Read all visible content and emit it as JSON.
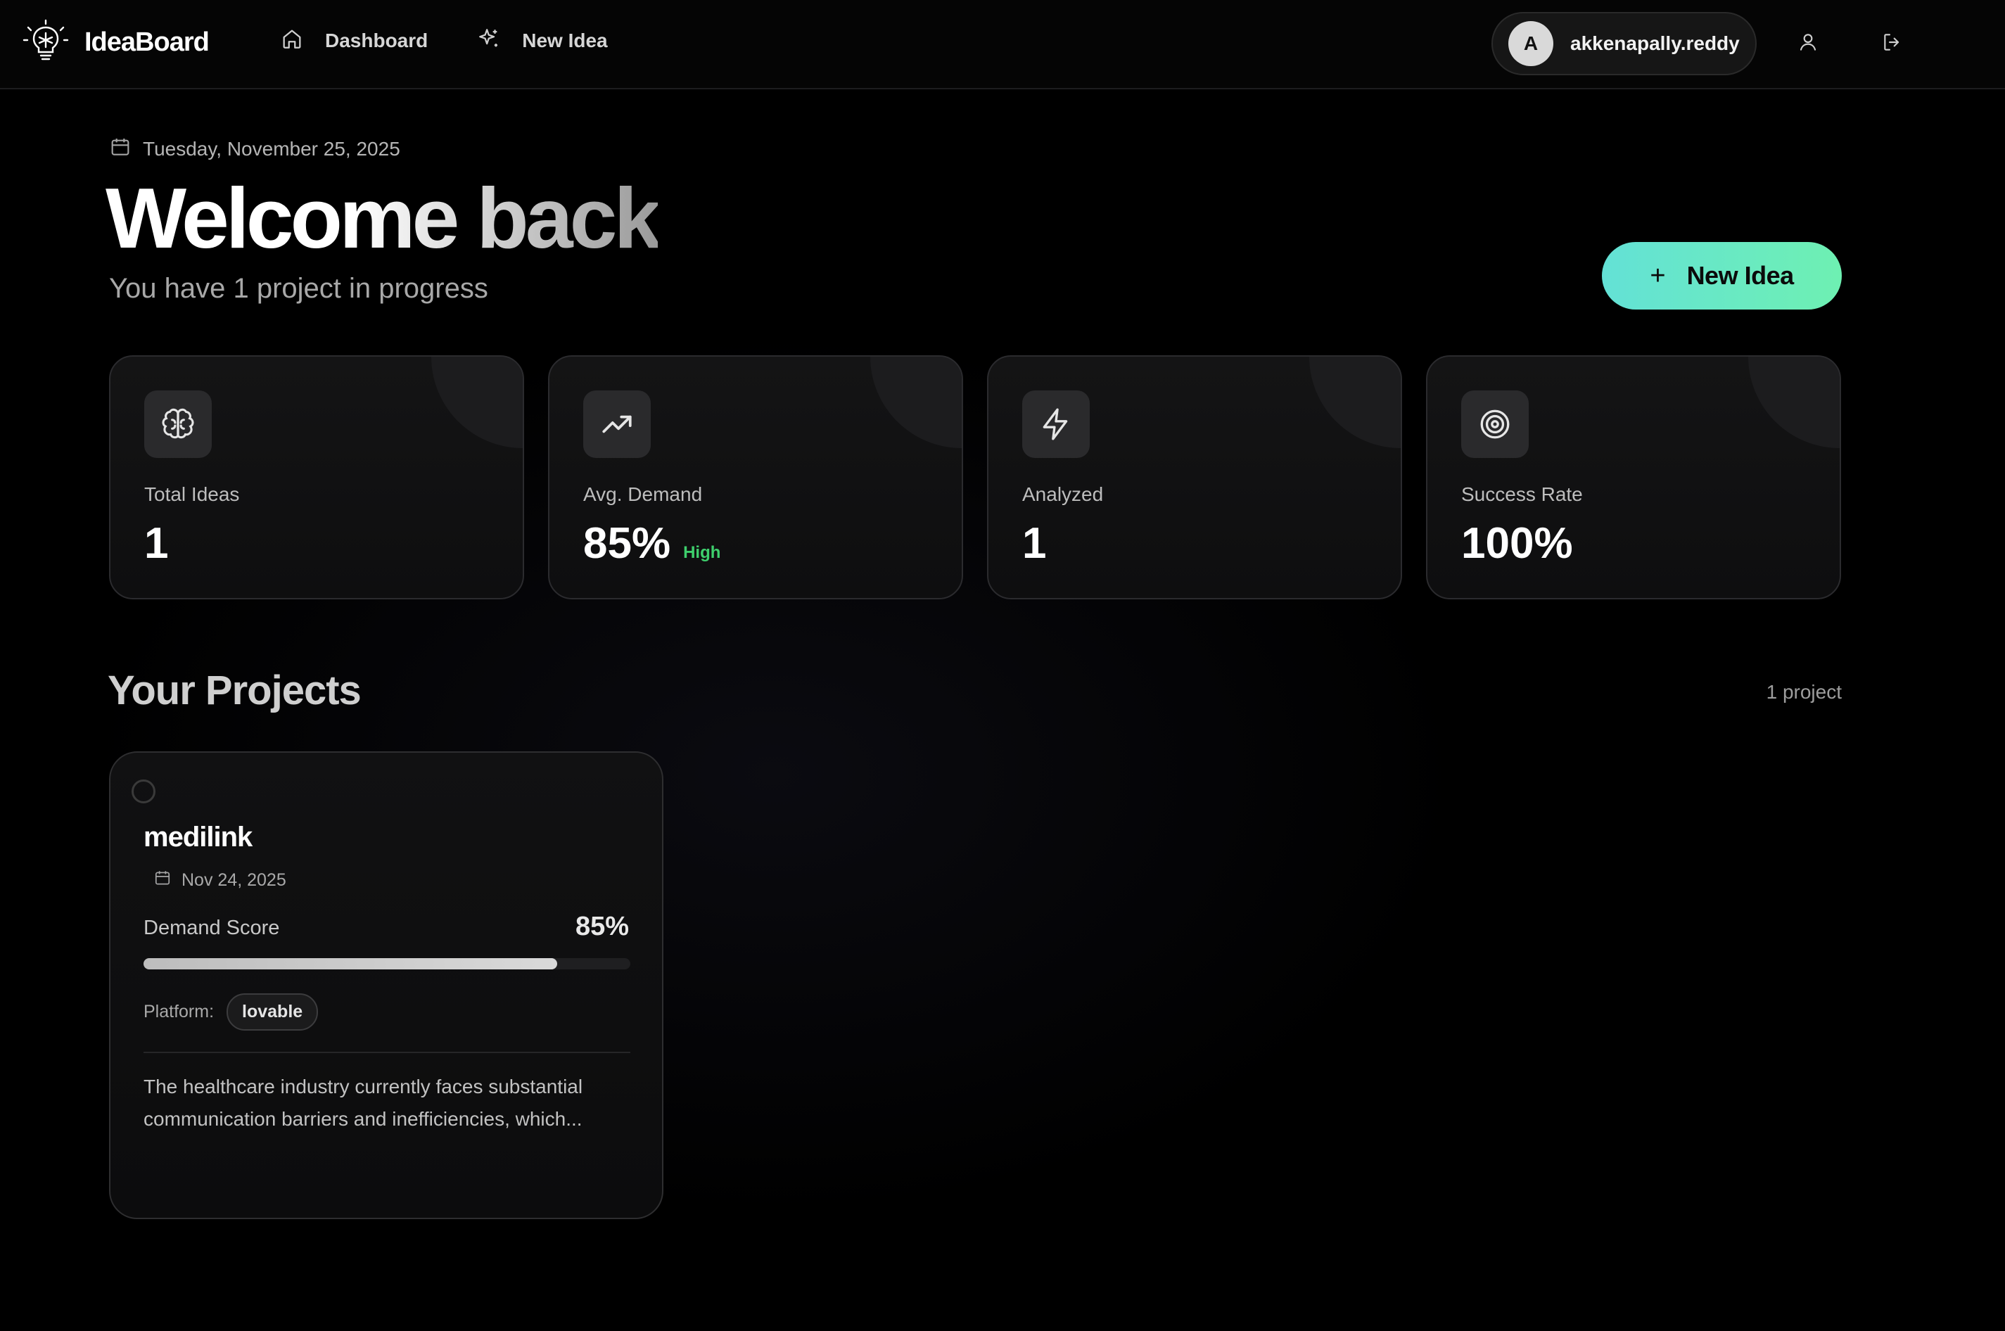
{
  "app": {
    "name": "IdeaBoard"
  },
  "nav": {
    "items": [
      {
        "label": "Dashboard",
        "icon": "home-icon"
      },
      {
        "label": "New Idea",
        "icon": "sparkle-icon"
      }
    ]
  },
  "user": {
    "initial": "A",
    "username": "akkenapally.reddy"
  },
  "header": {
    "date": "Tuesday, November 25, 2025",
    "welcome": "Welcome back",
    "subtitle": "You have 1 project in progress",
    "new_idea_button": "New Idea"
  },
  "stats": [
    {
      "label": "Total Ideas",
      "value": "1",
      "icon": "brain-icon"
    },
    {
      "label": "Avg. Demand",
      "value": "85%",
      "badge": "High",
      "icon": "trending-up-icon"
    },
    {
      "label": "Analyzed",
      "value": "1",
      "icon": "lightning-icon"
    },
    {
      "label": "Success Rate",
      "value": "100%",
      "icon": "target-icon"
    }
  ],
  "projects_section": {
    "title": "Your Projects",
    "count": "1 project"
  },
  "projects": [
    {
      "name": "medilink",
      "date": "Nov 24, 2025",
      "demand_label": "Demand Score",
      "demand_value": "85%",
      "demand_fraction": 0.85,
      "platform_label": "Platform:",
      "platform": "lovable",
      "description": "The healthcare industry currently faces substantial communication barriers and inefficiencies, which..."
    }
  ],
  "colors": {
    "accent_start": "#63e1d6",
    "accent_end": "#6ef0b2",
    "badge_high": "#3ecf6c",
    "background": "#000000"
  }
}
